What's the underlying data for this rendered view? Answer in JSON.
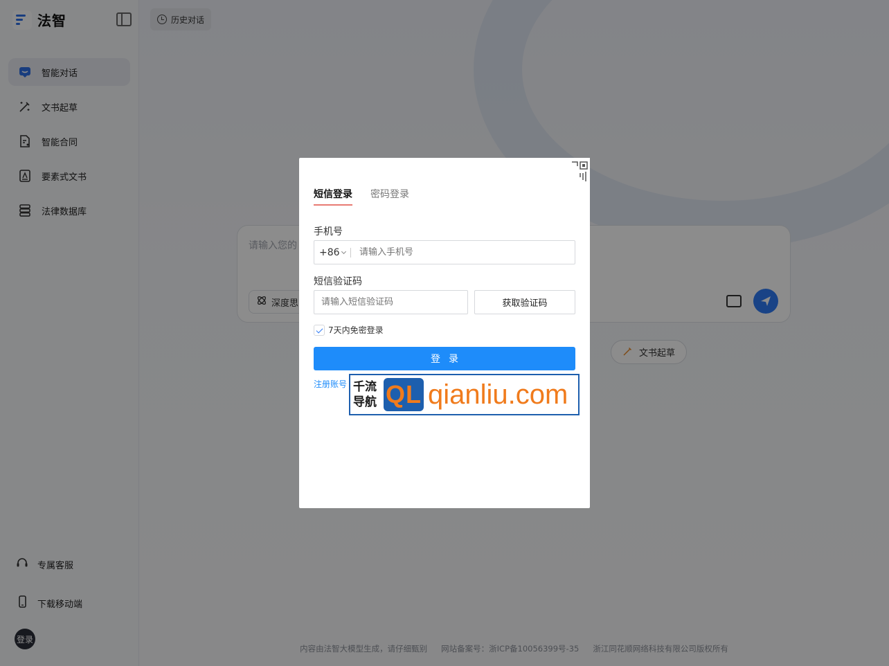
{
  "sidebar": {
    "logo_text": "法智",
    "items": [
      {
        "label": "智能对话",
        "icon": "chat-bubble-icon",
        "active": true
      },
      {
        "label": "文书起草",
        "icon": "pen-wand-icon"
      },
      {
        "label": "智能合同",
        "icon": "contract-document-icon"
      },
      {
        "label": "要素式文书",
        "icon": "element-document-icon"
      },
      {
        "label": "法律数据库",
        "icon": "database-icon"
      }
    ],
    "service": "专属客服",
    "download": "下载移动端",
    "login_avatar": "登录"
  },
  "header": {
    "history": "历史对话"
  },
  "chat": {
    "placeholder": "请输入您的",
    "deep_think": "深度思"
  },
  "chips": {
    "doc_draft": "文书起草"
  },
  "footer": {
    "disclaimer": "内容由法智大模型生成，请仔细甄别",
    "icp": "网站备案号：浙ICP备10056399号-35",
    "copyright": "浙江同花顺网络科技有限公司版权所有"
  },
  "login_modal": {
    "tabs": [
      {
        "label": "短信登录",
        "active": true
      },
      {
        "label": "密码登录",
        "active": false
      }
    ],
    "phone_label": "手机号",
    "country_code": "+86",
    "phone_placeholder": "请输入手机号",
    "code_label": "短信验证码",
    "code_placeholder": "请输入短信验证码",
    "get_code": "获取验证码",
    "remember": "7天内免密登录",
    "remember_checked": true,
    "submit": "登录",
    "register": "注册账号"
  },
  "watermark": {
    "cn_top": "千流",
    "cn_bottom": "导航",
    "mark": "QL",
    "url": "qianliu.com"
  },
  "colors": {
    "primary": "#1e8cfa",
    "tab_underline": "#e87a73",
    "watermark_orange": "#f07b1c",
    "watermark_blue": "#1d5fae"
  }
}
